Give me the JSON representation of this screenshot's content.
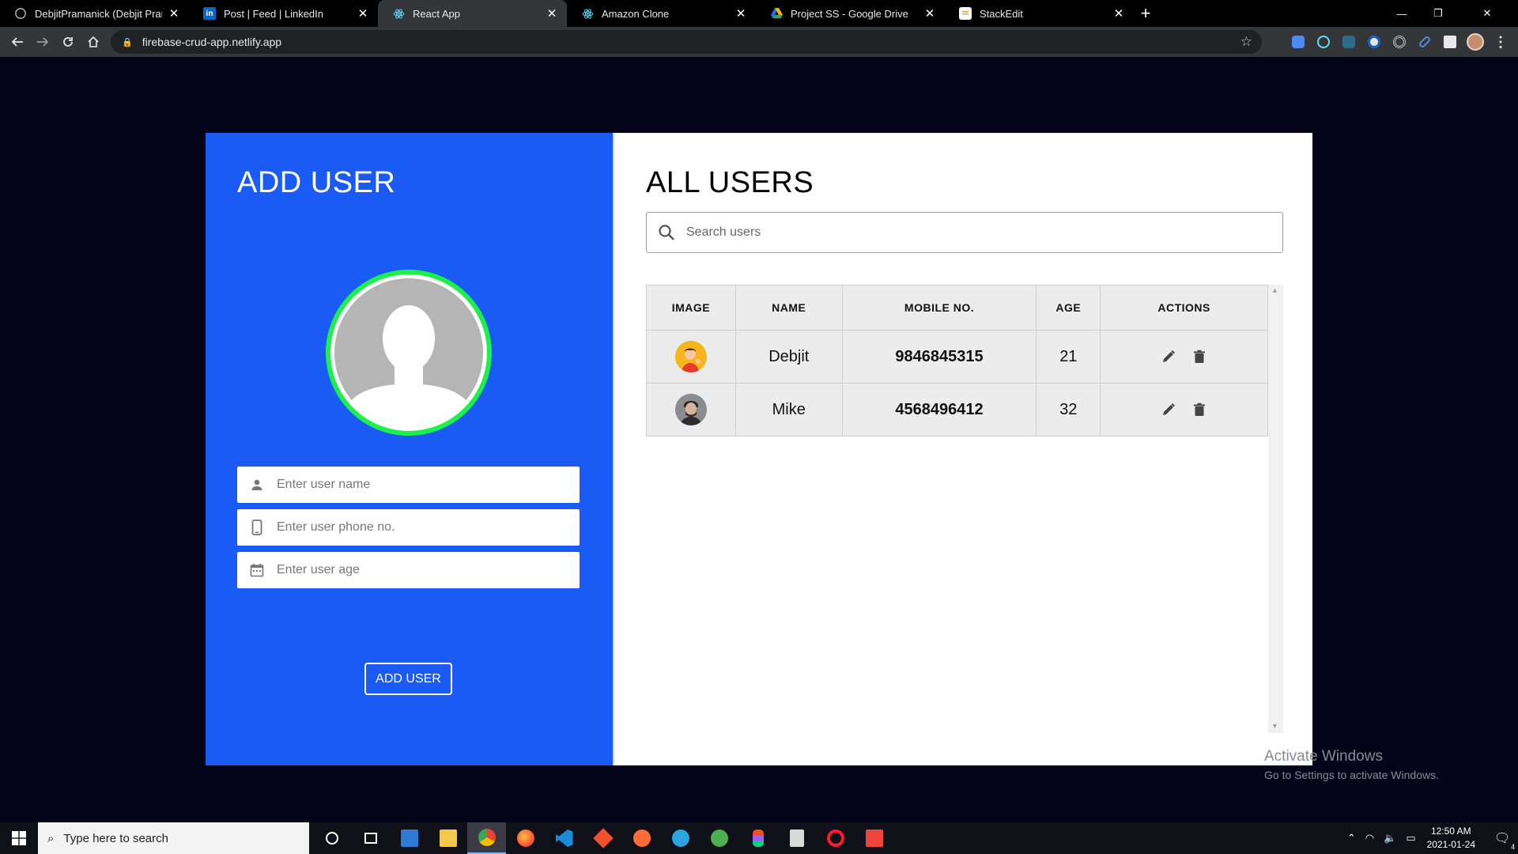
{
  "browser": {
    "tabs": [
      {
        "title": "DebjitPramanick (Debjit Pramanick)",
        "icon": "github-icon"
      },
      {
        "title": "Post | Feed | LinkedIn",
        "icon": "linkedin-icon"
      },
      {
        "title": "React App",
        "icon": "react-icon",
        "active": true
      },
      {
        "title": "Amazon Clone",
        "icon": "react-icon"
      },
      {
        "title": "Project SS - Google Drive",
        "icon": "google-drive-icon"
      },
      {
        "title": "StackEdit",
        "icon": "stackedit-icon"
      }
    ],
    "url": "firebase-crud-app.netlify.app"
  },
  "add_user": {
    "title": "ADD USER",
    "name_placeholder": "Enter user name",
    "phone_placeholder": "Enter user phone no.",
    "age_placeholder": "Enter user age",
    "button_label": "ADD USER"
  },
  "all_users": {
    "title": "ALL USERS",
    "search_placeholder": "Search users",
    "columns": [
      "IMAGE",
      "NAME",
      "MOBILE NO.",
      "AGE",
      "ACTIONS"
    ],
    "rows": [
      {
        "name": "Debjit",
        "mobile": "9846845315",
        "age": "21"
      },
      {
        "name": "Mike",
        "mobile": "4568496412",
        "age": "32"
      }
    ]
  },
  "watermark": {
    "line1": "Activate Windows",
    "line2": "Go to Settings to activate Windows."
  },
  "taskbar": {
    "search_placeholder": "Type here to search",
    "time": "12:50 AM",
    "date": "2021-01-24",
    "notification_count": "4"
  },
  "colors": {
    "left_panel": "#1b5bf5",
    "avatar_ring": "#1cf04a",
    "page_background": "#040418"
  }
}
